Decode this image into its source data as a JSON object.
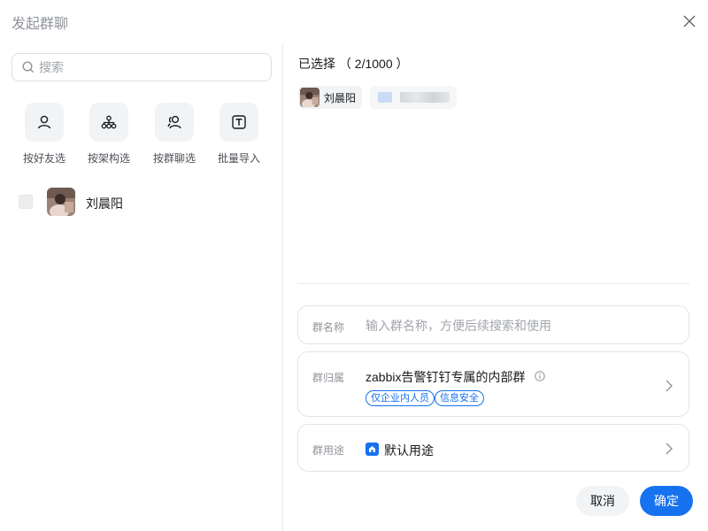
{
  "dialog": {
    "title": "发起群聊"
  },
  "search": {
    "placeholder": "搜索"
  },
  "shortcuts": [
    {
      "label": "按好友选",
      "icon": "person-icon"
    },
    {
      "label": "按架构选",
      "icon": "org-chart-icon"
    },
    {
      "label": "按群聊选",
      "icon": "group-icon"
    },
    {
      "label": "批量导入",
      "icon": "text-import-icon"
    }
  ],
  "contacts": [
    {
      "name": "刘晨阳",
      "checked": false
    }
  ],
  "selected": {
    "title": "已选择 （ 2/1000 ）",
    "items": [
      {
        "name": "刘晨阳"
      }
    ]
  },
  "group_name": {
    "label": "群名称",
    "placeholder": "输入群名称，方便后续搜索和使用"
  },
  "group_belong": {
    "label": "群归属",
    "value": "zabbix告警钉钉专属的内部群",
    "tags": [
      "仅企业内人员",
      "信息安全"
    ]
  },
  "group_usage": {
    "label": "群用途",
    "value": "默认用途"
  },
  "buttons": {
    "cancel": "取消",
    "confirm": "确定"
  },
  "colors": {
    "accent": "#1772ef",
    "muted": "#8f9399",
    "chip": "#f2f3f5"
  }
}
